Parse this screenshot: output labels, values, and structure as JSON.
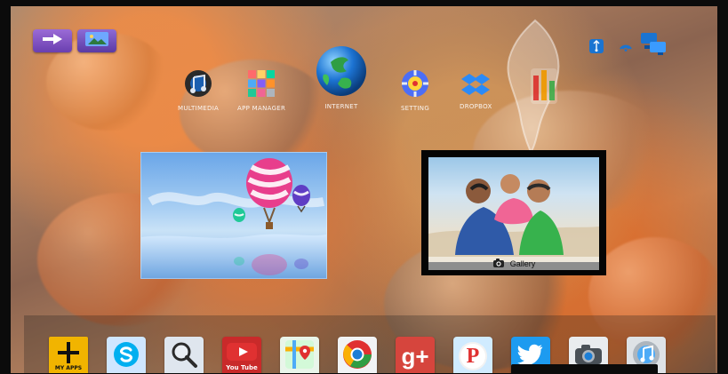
{
  "home": {
    "apps": [
      {
        "key": "multimedia",
        "label": "MULTIMEDIA",
        "icon": "multimedia-icon"
      },
      {
        "key": "app_manager",
        "label": "APP MANAGER",
        "icon": "app-manager-icon"
      },
      {
        "key": "internet",
        "label": "INTERNET",
        "icon": "globe-icon"
      },
      {
        "key": "setting",
        "label": "SETTING",
        "icon": "settings-icon"
      },
      {
        "key": "dropbox",
        "label": "DROPBOX",
        "icon": "dropbox-icon"
      }
    ],
    "gallery_label": "Gallery",
    "dock": [
      {
        "key": "my_apps",
        "label": "MY APPS",
        "icon": "plus-icon"
      },
      {
        "key": "skype",
        "label": "",
        "icon": "skype-icon"
      },
      {
        "key": "search",
        "label": "",
        "icon": "search-icon"
      },
      {
        "key": "youtube",
        "label": "You Tube",
        "icon": "youtube-icon"
      },
      {
        "key": "maps",
        "label": "",
        "icon": "maps-icon"
      },
      {
        "key": "chrome",
        "label": "",
        "icon": "chrome-icon"
      },
      {
        "key": "google_plus",
        "label": "g+",
        "icon": "google-plus-icon"
      },
      {
        "key": "pinterest",
        "label": "P",
        "icon": "pinterest-icon"
      },
      {
        "key": "twitter",
        "label": "",
        "icon": "twitter-icon"
      },
      {
        "key": "camera",
        "label": "",
        "icon": "camera-icon"
      },
      {
        "key": "music",
        "label": "",
        "icon": "music-icon"
      }
    ]
  }
}
